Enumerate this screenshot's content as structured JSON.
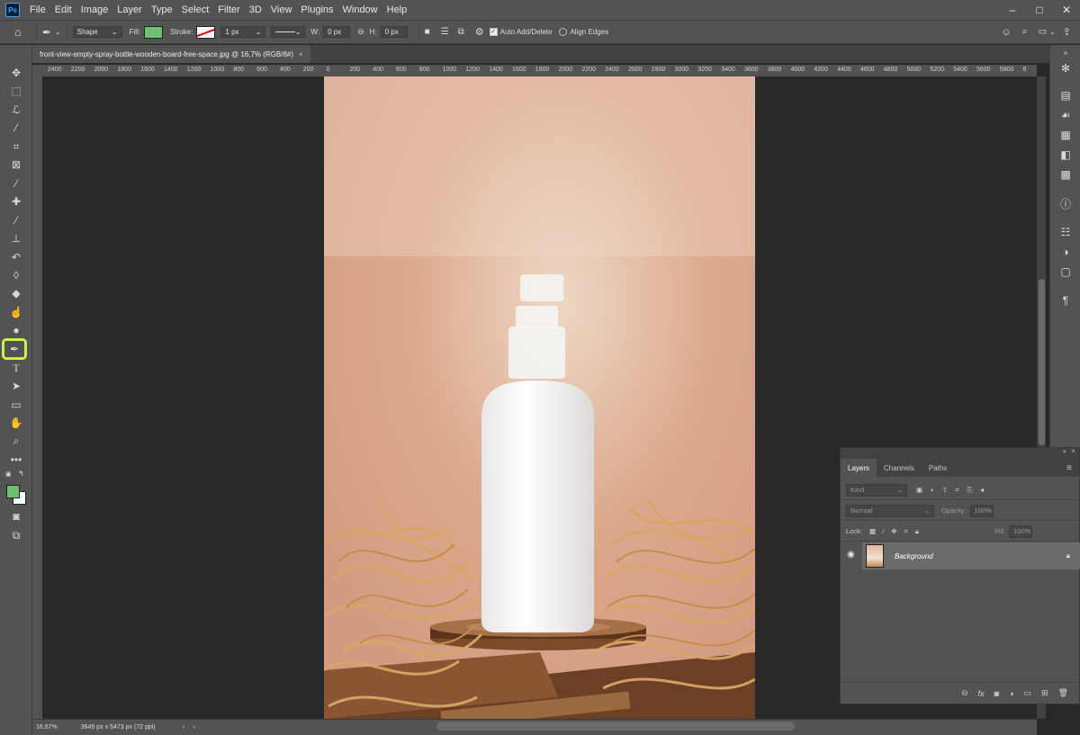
{
  "menubar": {
    "logo": "Ps",
    "items": [
      "File",
      "Edit",
      "Image",
      "Layer",
      "Type",
      "Select",
      "Filter",
      "3D",
      "View",
      "Plugins",
      "Window",
      "Help"
    ],
    "window_controls": [
      "–",
      "□",
      "✕"
    ]
  },
  "options": {
    "mode": "Shape",
    "fill_label": "Fill:",
    "fill_color": "#6fbf73",
    "stroke_label": "Stroke:",
    "stroke_width": "1 px",
    "w_label": "W:",
    "w_value": "0 px",
    "h_label": "H:",
    "h_value": "0 px",
    "auto_add_delete": "Auto Add/Delete",
    "align_edges": "Align Edges"
  },
  "document": {
    "tab_title": "front-view-empty-spray-bottle-wooden-board-free-space.jpg @ 16,7% (RGB/8#)",
    "close": "×"
  },
  "ruler": {
    "h_ticks": [
      "2400",
      "2200",
      "2000",
      "1800",
      "1600",
      "1400",
      "1200",
      "1000",
      "800",
      "600",
      "400",
      "200",
      "0",
      "200",
      "400",
      "600",
      "800",
      "1000",
      "1200",
      "1400",
      "1600",
      "1800",
      "2000",
      "2200",
      "2400",
      "2600",
      "2800",
      "3000",
      "3200",
      "3400",
      "3600",
      "3800",
      "4000",
      "4200",
      "4400",
      "4600",
      "4800",
      "5000",
      "5200",
      "5400",
      "5600",
      "5800",
      "6"
    ]
  },
  "status": {
    "zoom": "16,67%",
    "doc_info": "3649 px x 5473 px (72 ppi)"
  },
  "layers": {
    "tabs": [
      "Layers",
      "Channels",
      "Paths"
    ],
    "active_tab": "Layers",
    "kind_label": "Kind",
    "blend_mode": "Normal",
    "opacity_label": "Opacity:",
    "opacity_value": "100%",
    "lock_label": "Lock:",
    "fill_label": "Fill:",
    "fill_value": "100%",
    "items": [
      {
        "name": "Background",
        "visible": true,
        "locked": true
      }
    ]
  },
  "colors": {
    "foreground": "#6fbf73",
    "background": "#ffffff",
    "highlight": "#c9f34b"
  }
}
